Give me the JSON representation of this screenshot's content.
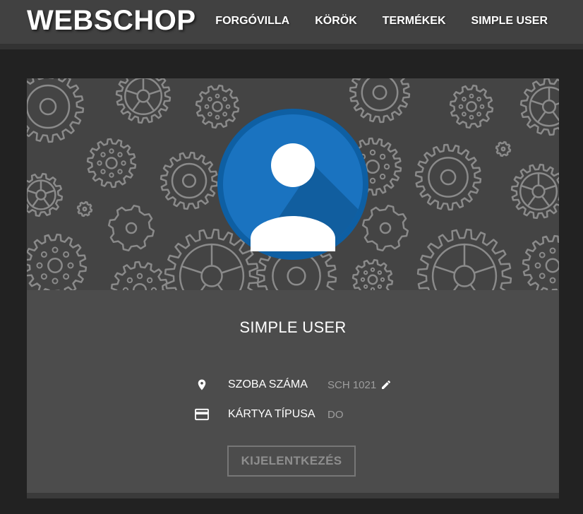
{
  "navbar": {
    "brand": "WEBSCHOP",
    "links": [
      {
        "label": "FORGÓVILLA"
      },
      {
        "label": "KÖRÖK"
      },
      {
        "label": "TERMÉKEK"
      },
      {
        "label": "SIMPLE USER"
      }
    ]
  },
  "profile": {
    "name": "SIMPLE USER",
    "avatar_icon": "account-circle-icon",
    "fields": [
      {
        "icon": "location-pin-icon",
        "label": "SZOBA SZÁMA",
        "value": "SCH 1021",
        "editable": true,
        "edit_icon": "pencil-icon"
      },
      {
        "icon": "credit-card-icon",
        "label": "KÁRTYA TÍPUSA",
        "value": "DO",
        "editable": false
      }
    ],
    "logout_label": "KIJELENTKEZÉS"
  },
  "colors": {
    "navbar": "#414141",
    "page_background": "#222222",
    "card": "#4c4c4c",
    "banner": "#444444",
    "gear_stroke": "#8a8a8a",
    "avatar_ring": "#0e5fa3",
    "avatar_fill": "#1a73c0",
    "avatar_shadow": "#0f5794"
  }
}
